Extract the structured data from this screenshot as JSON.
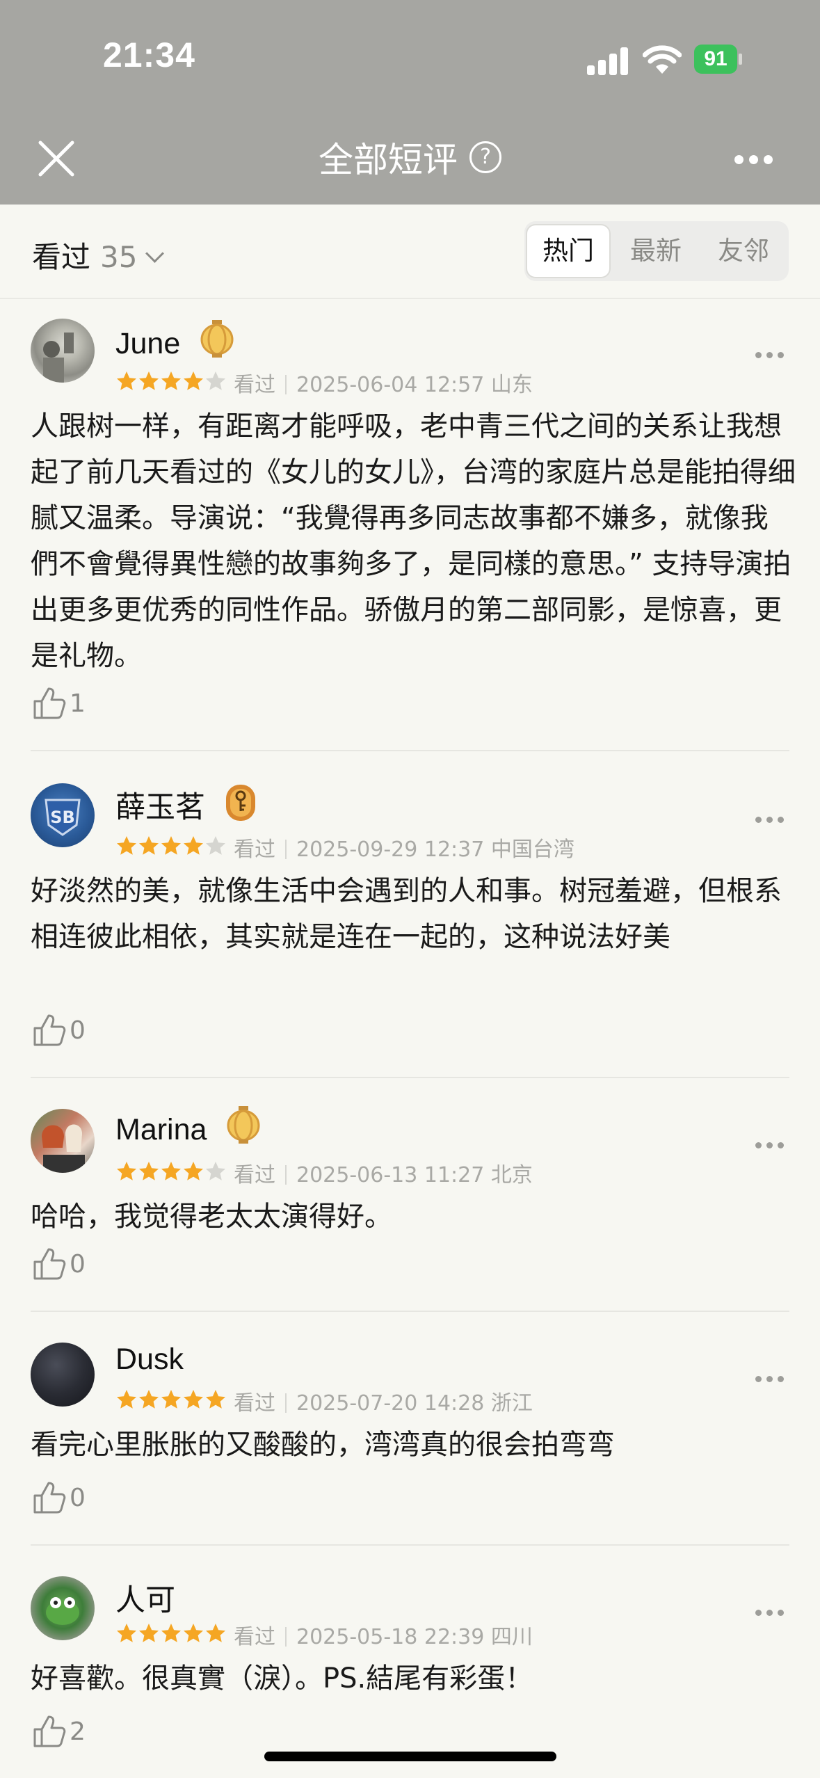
{
  "status_bar": {
    "time": "21:34",
    "battery": "91"
  },
  "nav": {
    "title": "全部短评",
    "help": "?"
  },
  "filter": {
    "label": "看过",
    "count": "35",
    "tabs": [
      "热门",
      "最新",
      "友邻"
    ],
    "active_tab": "热门"
  },
  "comments": [
    {
      "user": "June",
      "rating": 4,
      "status": "看过",
      "datetime": "2025-06-04 12:57",
      "location": "山东",
      "text": "人跟树一样，有距离才能呼吸，老中青三代之间的关系让我想起了前几天看过的《女儿的女儿》，台湾的家庭片总是能拍得细腻又温柔。导演说：“我覺得再多同志故事都不嫌多，就像我們不會覺得異性戀的故事夠多了，是同樣的意思。” 支持导演拍出更多更优秀的同性作品。骄傲月的第二部同影，是惊喜，更是礼物。",
      "likes": "1"
    },
    {
      "user": "薛玉茗",
      "rating": 4,
      "status": "看过",
      "datetime": "2025-09-29 12:37",
      "location": "中国台湾",
      "text": "好淡然的美，就像生活中会遇到的人和事。树冠羞避，但根系相连彼此相依，其实就是连在一起的，这种说法好美",
      "likes": "0"
    },
    {
      "user": "Marina",
      "rating": 4,
      "status": "看过",
      "datetime": "2025-06-13 11:27",
      "location": "北京",
      "text": "哈哈，我觉得老太太演得好。",
      "likes": "0"
    },
    {
      "user": "Dusk",
      "rating": 5,
      "status": "看过",
      "datetime": "2025-07-20 14:28",
      "location": "浙江",
      "text": "看完心里胀胀的又酸酸的，湾湾真的很会拍弯弯",
      "likes": "0"
    },
    {
      "user": "人可",
      "rating": 5,
      "status": "看过",
      "datetime": "2025-05-18 22:39",
      "location": "四川",
      "text": "好喜歡。很真實（淚）。PS.結尾有彩蛋！",
      "likes": "2"
    }
  ],
  "colors": {
    "star": "#f5a623",
    "star_empty": "#d5d5d0",
    "header_bg": "#a6a6a2",
    "battery": "#3cc15c"
  }
}
